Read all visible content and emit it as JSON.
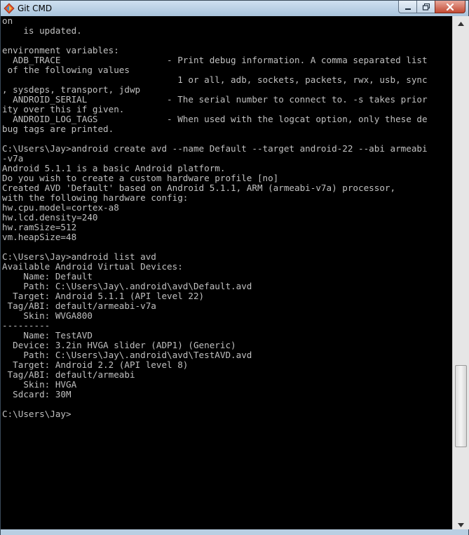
{
  "window": {
    "title": "Git CMD",
    "icon": "git-diamond-icon"
  },
  "caption_buttons": {
    "minimize_icon": "minimize-icon",
    "maximize_icon": "maximize-icon",
    "close_icon": "close-icon"
  },
  "console": {
    "text": "on\n    is updated.\n\nenvironment variables:\n  ADB_TRACE                    - Print debug information. A comma separated list\n of the following values\n                                 1 or all, adb, sockets, packets, rwx, usb, sync\n, sysdeps, transport, jdwp\n  ANDROID_SERIAL               - The serial number to connect to. -s takes prior\nity over this if given.\n  ANDROID_LOG_TAGS             - When used with the logcat option, only these de\nbug tags are printed.\n\nC:\\Users\\Jay>android create avd --name Default --target android-22 --abi armeabi\n-v7a\nAndroid 5.1.1 is a basic Android platform.\nDo you wish to create a custom hardware profile [no]\nCreated AVD 'Default' based on Android 5.1.1, ARM (armeabi-v7a) processor,\nwith the following hardware config:\nhw.cpu.model=cortex-a8\nhw.lcd.density=240\nhw.ramSize=512\nvm.heapSize=48\n\nC:\\Users\\Jay>android list avd\nAvailable Android Virtual Devices:\n    Name: Default\n    Path: C:\\Users\\Jay\\.android\\avd\\Default.avd\n  Target: Android 5.1.1 (API level 22)\n Tag/ABI: default/armeabi-v7a\n    Skin: WVGA800\n---------\n    Name: TestAVD\n  Device: 3.2in HVGA slider (ADP1) (Generic)\n    Path: C:\\Users\\Jay\\.android\\avd\\TestAVD.avd\n  Target: Android 2.2 (API level 8)\n Tag/ABI: default/armeabi\n    Skin: HVGA\n  Sdcard: 30M\n\nC:\\Users\\Jay>"
  },
  "scrollbar": {
    "up_icon": "scroll-up-arrow-icon",
    "down_icon": "scroll-down-arrow-icon"
  },
  "colors": {
    "console_background": "#000000",
    "console_text": "#c0c0c0",
    "close_button": "#c24a33"
  }
}
